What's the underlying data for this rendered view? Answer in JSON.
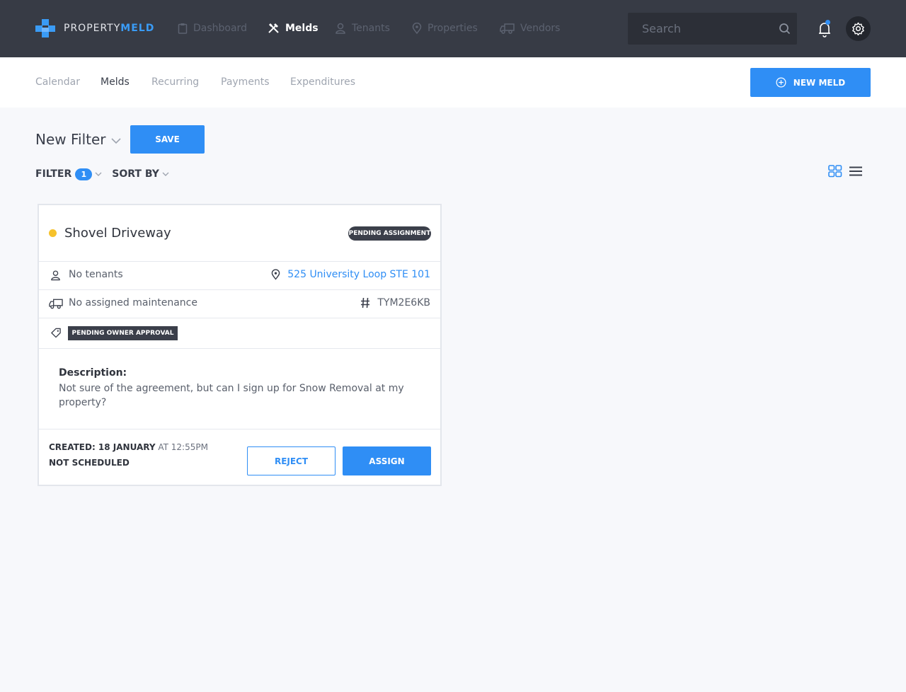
{
  "colors": {
    "accent": "#2f8ef5",
    "nav_bg": "#373b45",
    "status_pending": "#f6c22c"
  },
  "brand": {
    "name_part1": "PROPERTY",
    "name_part2": "MELD"
  },
  "top_nav": {
    "items": [
      {
        "label": "Dashboard",
        "icon": "clipboard-icon"
      },
      {
        "label": "Melds",
        "icon": "tools-icon",
        "active": true
      },
      {
        "label": "Tenants",
        "icon": "person-icon"
      },
      {
        "label": "Properties",
        "icon": "map-pin-icon"
      },
      {
        "label": "Vendors",
        "icon": "truck-icon"
      }
    ],
    "search": {
      "placeholder": "Search"
    }
  },
  "sub_nav": {
    "items": [
      {
        "label": "Calendar"
      },
      {
        "label": "Melds",
        "active": true
      },
      {
        "label": "Recurring"
      },
      {
        "label": "Payments"
      },
      {
        "label": "Expenditures"
      }
    ],
    "new_meld_label": "NEW MELD"
  },
  "filter_bar": {
    "title": "New Filter",
    "save_label": "SAVE",
    "filter_label": "FILTER",
    "filter_count": "1",
    "sort_label": "SORT BY"
  },
  "meld_card": {
    "title": "Shovel Driveway",
    "status_badge": "PENDING ASSIGNMENT",
    "tenants": "No tenants",
    "address": "525 University Loop STE 101",
    "maintenance": "No assigned maintenance",
    "meld_id": "TYM2E6KB",
    "tag": "PENDING OWNER APPROVAL",
    "description_label": "Description:",
    "description": "Not sure of the agreement, but can I sign up for Snow Removal at my property?",
    "created_prefix": "CREATED: 18 JANUARY",
    "created_at": " AT 12:55PM",
    "schedule": "NOT SCHEDULED",
    "reject_label": "REJECT",
    "assign_label": "ASSIGN"
  }
}
